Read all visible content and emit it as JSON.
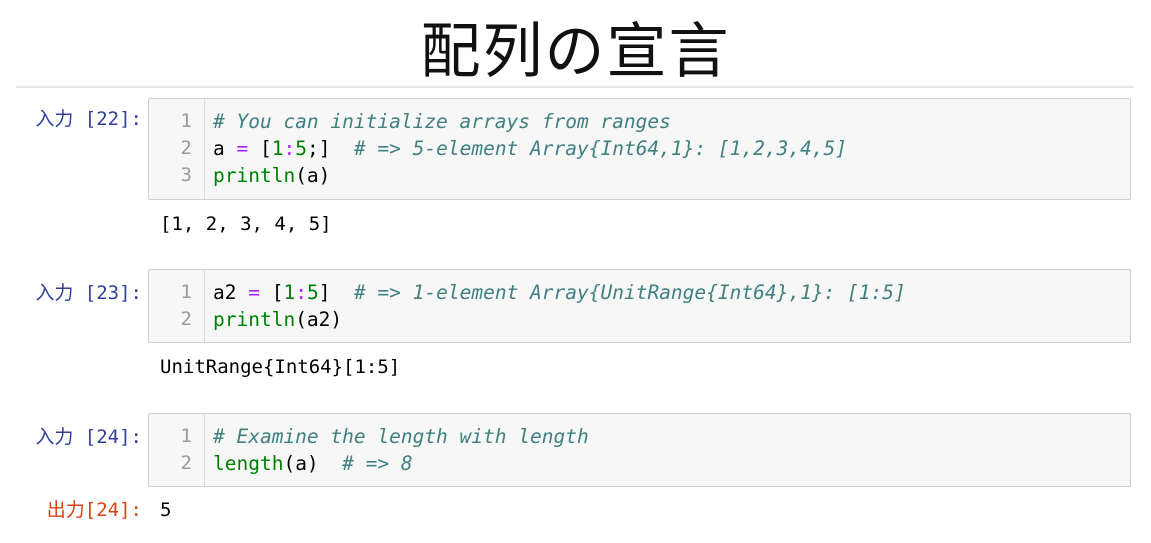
{
  "page": {
    "title": "配列の宣言"
  },
  "cells": [
    {
      "prompt": "入力 [22]:",
      "line_numbers": [
        "1",
        "2",
        "3"
      ],
      "lines": [
        [
          {
            "t": "# You can initialize arrays from ranges",
            "c": "comment"
          }
        ],
        [
          {
            "t": "a ",
            "c": "plain"
          },
          {
            "t": "=",
            "c": "op"
          },
          {
            "t": " [",
            "c": "plain"
          },
          {
            "t": "1",
            "c": "num"
          },
          {
            "t": ":",
            "c": "op"
          },
          {
            "t": "5",
            "c": "num"
          },
          {
            "t": ";]  ",
            "c": "plain"
          },
          {
            "t": "# => 5-element Array{Int64,1}: [1,2,3,4,5]",
            "c": "comment"
          }
        ],
        [
          {
            "t": "println",
            "c": "builtin"
          },
          {
            "t": "(a)",
            "c": "plain"
          }
        ]
      ],
      "output": "[1, 2, 3, 4, 5]"
    },
    {
      "prompt": "入力 [23]:",
      "line_numbers": [
        "1",
        "2"
      ],
      "lines": [
        [
          {
            "t": "a2 ",
            "c": "plain"
          },
          {
            "t": "=",
            "c": "op"
          },
          {
            "t": " [",
            "c": "plain"
          },
          {
            "t": "1",
            "c": "num"
          },
          {
            "t": ":",
            "c": "op"
          },
          {
            "t": "5",
            "c": "num"
          },
          {
            "t": "]  ",
            "c": "plain"
          },
          {
            "t": "# => 1-element Array{UnitRange{Int64},1}: [1:5]",
            "c": "comment"
          }
        ],
        [
          {
            "t": "println",
            "c": "builtin"
          },
          {
            "t": "(a2)",
            "c": "plain"
          }
        ]
      ],
      "output": "UnitRange{Int64}[1:5]"
    },
    {
      "prompt": "入力 [24]:",
      "line_numbers": [
        "1",
        "2"
      ],
      "lines": [
        [
          {
            "t": "# Examine the length with length",
            "c": "comment"
          }
        ],
        [
          {
            "t": "length",
            "c": "builtin"
          },
          {
            "t": "(a)  ",
            "c": "plain"
          },
          {
            "t": "# => 8",
            "c": "comment"
          }
        ]
      ],
      "output_prompt": "出力[24]:",
      "output": "5"
    }
  ]
}
